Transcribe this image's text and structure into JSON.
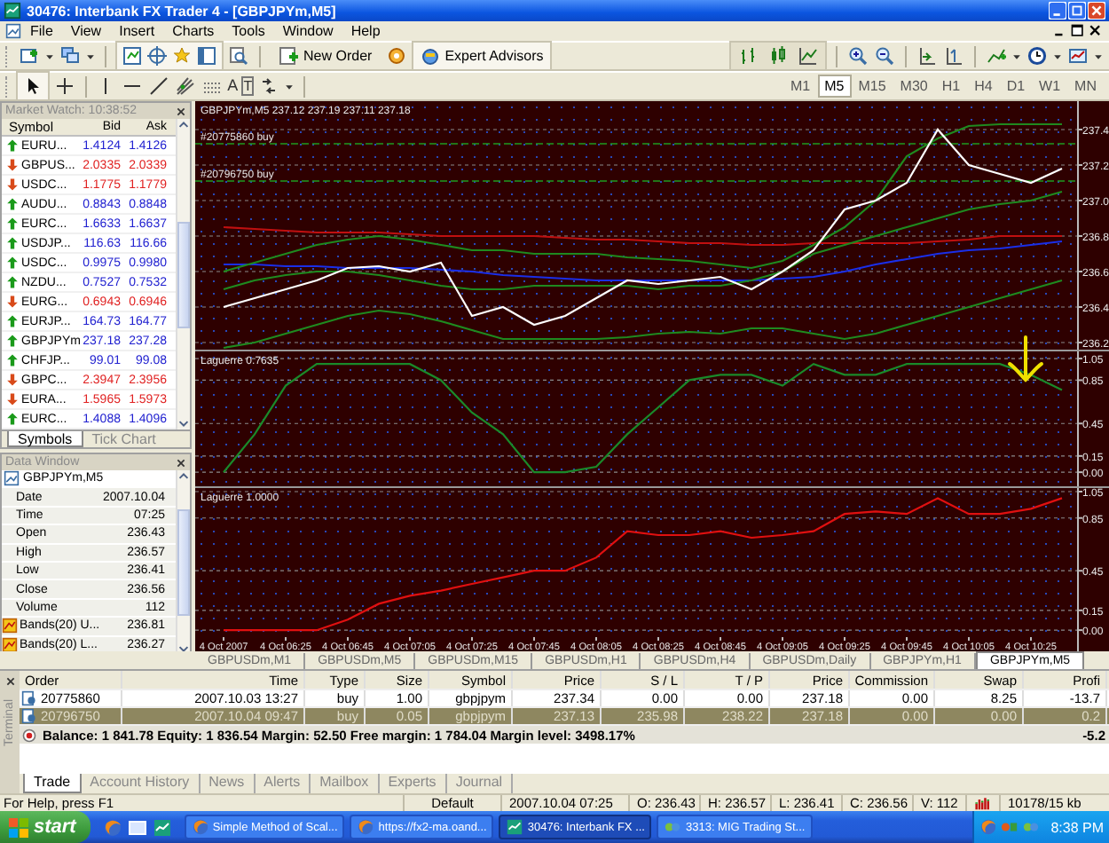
{
  "window": {
    "title": "30476: Interbank FX Trader 4 - [GBPJPYm,M5]"
  },
  "menu": [
    "File",
    "View",
    "Insert",
    "Charts",
    "Tools",
    "Window",
    "Help"
  ],
  "toolbar": {
    "buttons": [
      {
        "kind": "new-order",
        "label": "New Order"
      },
      {
        "kind": "expert-advisors",
        "label": "Expert Advisors"
      }
    ]
  },
  "drawing_tools": [
    {
      "kind": "text",
      "label": "A"
    },
    {
      "kind": "label",
      "label": "T"
    }
  ],
  "timeframes": [
    {
      "label": "M1",
      "selected": false
    },
    {
      "label": "M5",
      "selected": true
    },
    {
      "label": "M15",
      "selected": false
    },
    {
      "label": "M30",
      "selected": false
    },
    {
      "label": "H1",
      "selected": false
    },
    {
      "label": "H4",
      "selected": false
    },
    {
      "label": "D1",
      "selected": false
    },
    {
      "label": "W1",
      "selected": false
    },
    {
      "label": "MN",
      "selected": false
    }
  ],
  "market_watch": {
    "title": "Market Watch: 10:38:52",
    "columns": [
      "Symbol",
      "Bid",
      "Ask"
    ],
    "rows": [
      {
        "symbol": "EURU...",
        "bid": "1.4124",
        "ask": "1.4126",
        "rising": true
      },
      {
        "symbol": "GBPUS...",
        "bid": "2.0335",
        "ask": "2.0339",
        "rising": false
      },
      {
        "symbol": "USDC...",
        "bid": "1.1775",
        "ask": "1.1779",
        "rising": false
      },
      {
        "symbol": "AUDU...",
        "bid": "0.8843",
        "ask": "0.8848",
        "rising": true
      },
      {
        "symbol": "EURC...",
        "bid": "1.6633",
        "ask": "1.6637",
        "rising": true
      },
      {
        "symbol": "USDJP...",
        "bid": "116.63",
        "ask": "116.66",
        "rising": true
      },
      {
        "symbol": "USDC...",
        "bid": "0.9975",
        "ask": "0.9980",
        "rising": true
      },
      {
        "symbol": "NZDU...",
        "bid": "0.7527",
        "ask": "0.7532",
        "rising": true
      },
      {
        "symbol": "EURG...",
        "bid": "0.6943",
        "ask": "0.6946",
        "rising": false
      },
      {
        "symbol": "EURJP...",
        "bid": "164.73",
        "ask": "164.77",
        "rising": true
      },
      {
        "symbol": "GBPJPYm",
        "bid": "237.18",
        "ask": "237.28",
        "rising": true
      },
      {
        "symbol": "CHFJP...",
        "bid": "99.01",
        "ask": "99.08",
        "rising": true
      },
      {
        "symbol": "GBPC...",
        "bid": "2.3947",
        "ask": "2.3956",
        "rising": false
      },
      {
        "symbol": "EURA...",
        "bid": "1.5965",
        "ask": "1.5973",
        "rising": false
      },
      {
        "symbol": "EURC...",
        "bid": "1.4088",
        "ask": "1.4096",
        "rising": true
      }
    ],
    "tabs": [
      {
        "label": "Symbols",
        "selected": true
      },
      {
        "label": "Tick Chart",
        "selected": false
      }
    ]
  },
  "data_window": {
    "title": "Data Window",
    "chart": "GBPJPYm,M5",
    "rows": [
      {
        "kind": "field",
        "label": "Date",
        "value": "2007.10.04"
      },
      {
        "kind": "field",
        "label": "Time",
        "value": "07:25"
      },
      {
        "kind": "field",
        "label": "Open",
        "value": "236.43"
      },
      {
        "kind": "field",
        "label": "High",
        "value": "236.57"
      },
      {
        "kind": "field",
        "label": "Low",
        "value": "236.41"
      },
      {
        "kind": "field",
        "label": "Close",
        "value": "236.56"
      },
      {
        "kind": "field",
        "label": "Volume",
        "value": "112"
      },
      {
        "kind": "indicator",
        "label": "Bands(20) U...",
        "value": "236.81"
      },
      {
        "kind": "indicator",
        "label": "Bands(20) L...",
        "value": "236.27"
      }
    ]
  },
  "charts": [
    {
      "chart_data": {
        "type": "line",
        "title": "GBPJPYm,M5  237.12 237.19 237.11 237.18",
        "ylim": [
          236.16,
          237.56
        ],
        "yticks": [
          {
            "value": 237.4,
            "label": "237.4"
          },
          {
            "value": 237.2,
            "label": "237.2"
          },
          {
            "value": 237.0,
            "label": "237.0"
          },
          {
            "value": 236.8,
            "label": "236.8"
          },
          {
            "value": 236.6,
            "label": "236.6"
          },
          {
            "value": 236.4,
            "label": "236.4"
          },
          {
            "value": 236.2,
            "label": "236.2"
          }
        ],
        "series": [
          {
            "color": "#c01010",
            "values": [
              236.85,
              236.84,
              236.83,
              236.82,
              236.82,
              236.82,
              236.81,
              236.8,
              236.8,
              236.8,
              236.8,
              236.79,
              236.78,
              236.78,
              236.77,
              236.76,
              236.76,
              236.75,
              236.75,
              236.76,
              236.76,
              236.76,
              236.76,
              236.77,
              236.78,
              236.8,
              236.8,
              236.8
            ]
          },
          {
            "color": "#1a2ee8",
            "values": [
              236.64,
              236.64,
              236.63,
              236.63,
              236.62,
              236.62,
              236.62,
              236.61,
              236.6,
              236.58,
              236.57,
              236.56,
              236.55,
              236.55,
              236.55,
              236.55,
              236.55,
              236.55,
              236.56,
              236.57,
              236.6,
              236.64,
              236.67,
              236.7,
              236.72,
              236.73,
              236.75,
              236.77
            ]
          },
          {
            "color": "#1f8a1f",
            "values": [
              236.6,
              236.65,
              236.7,
              236.75,
              236.78,
              236.8,
              236.78,
              236.75,
              236.72,
              236.72,
              236.7,
              236.7,
              236.7,
              236.68,
              236.67,
              236.66,
              236.64,
              236.62,
              236.66,
              236.75,
              236.85,
              237.0,
              237.25,
              237.35,
              237.42,
              237.43,
              237.43,
              237.43
            ]
          },
          {
            "color": "#1f8a1f",
            "values": [
              236.5,
              236.55,
              236.58,
              236.6,
              236.6,
              236.58,
              236.55,
              236.52,
              236.5,
              236.5,
              236.52,
              236.52,
              236.52,
              236.52,
              236.5,
              236.52,
              236.52,
              236.55,
              236.6,
              236.7,
              236.75,
              236.8,
              236.85,
              236.9,
              236.95,
              236.98,
              237.0,
              237.05
            ]
          },
          {
            "color": "#1f8a1f",
            "values": [
              236.17,
              236.2,
              236.25,
              236.3,
              236.35,
              236.38,
              236.36,
              236.32,
              236.27,
              236.22,
              236.22,
              236.22,
              236.22,
              236.23,
              236.25,
              236.26,
              236.25,
              236.28,
              236.28,
              236.25,
              236.22,
              236.25,
              236.3,
              236.35,
              236.4,
              236.45,
              236.5,
              236.55
            ]
          },
          {
            "color": "#ffffff",
            "values": [
              236.4,
              236.45,
              236.5,
              236.55,
              236.62,
              236.63,
              236.6,
              236.65,
              236.35,
              236.4,
              236.3,
              236.35,
              236.45,
              236.55,
              236.53,
              236.55,
              236.57,
              236.5,
              236.6,
              236.72,
              236.95,
              237.0,
              237.1,
              237.4,
              237.2,
              237.15,
              237.1,
              237.18
            ]
          }
        ],
        "grid": true,
        "ref_lines": [
          {
            "axis": "y",
            "value": 237.32,
            "label": "#20775860 buy"
          },
          {
            "axis": "y",
            "value": 237.11,
            "label": "#20796750 buy"
          }
        ]
      }
    },
    {
      "chart_data": {
        "type": "line",
        "title": "Laguerre 0.7635",
        "ylim": [
          -0.13,
          1.116
        ],
        "grid": true,
        "yticks": [
          {
            "value": 1.05,
            "label": "1.05"
          },
          {
            "value": 0.85,
            "label": "0.85"
          },
          {
            "value": 0.45,
            "label": "0.45"
          },
          {
            "value": 0.15,
            "label": "0.15"
          },
          {
            "value": 0,
            "label": "0.00"
          }
        ],
        "series": [
          {
            "color": "#1a8a2a",
            "values": [
              0.0,
              0.35,
              0.8,
              1.0,
              1.0,
              1.0,
              1.0,
              0.85,
              0.55,
              0.35,
              0.0,
              0.0,
              0.05,
              0.35,
              0.6,
              0.85,
              0.9,
              0.9,
              0.8,
              1.0,
              0.9,
              0.9,
              1.0,
              1.0,
              1.0,
              1.0,
              0.9,
              0.76
            ]
          }
        ]
      }
    },
    {
      "chart_data": {
        "type": "line",
        "title": "Laguerre 1.0000",
        "ylim": [
          -0.053,
          1.077
        ],
        "grid": true,
        "categories": [
          "4 Oct 2007",
          null,
          "4 Oct 06:25",
          null,
          "4 Oct 06:45",
          null,
          "4 Oct 07:05",
          null,
          "4 Oct 07:25",
          null,
          "4 Oct 07:45",
          null,
          "4 Oct 08:05",
          null,
          "4 Oct 08:25",
          null,
          "4 Oct 08:45",
          null,
          "4 Oct 09:05",
          null,
          "4 Oct 09:25",
          null,
          "4 Oct 09:45",
          null,
          "4 Oct 10:05",
          null,
          "4 Oct 10:25",
          null
        ],
        "yticks": [
          {
            "value": 1.05,
            "label": "1.05"
          },
          {
            "value": 0.85,
            "label": "0.85"
          },
          {
            "value": 0.45,
            "label": "0.45"
          },
          {
            "value": 0.15,
            "label": "0.15"
          },
          {
            "value": 0,
            "label": "0.00"
          }
        ],
        "series": [
          {
            "color": "#e01010",
            "values": [
              0,
              0,
              0,
              0,
              0.08,
              0.2,
              0.26,
              0.3,
              0.35,
              0.4,
              0.45,
              0.45,
              0.55,
              0.75,
              0.72,
              0.72,
              0.75,
              0.7,
              0.72,
              0.75,
              0.88,
              0.9,
              0.88,
              1.0,
              0.88,
              0.88,
              0.92,
              1.0
            ]
          }
        ]
      }
    }
  ],
  "chart_tabs": [
    {
      "label": "GBPUSDm,M1",
      "selected": false
    },
    {
      "label": "GBPUSDm,M5",
      "selected": false
    },
    {
      "label": "GBPUSDm,M15",
      "selected": false
    },
    {
      "label": "GBPUSDm,H1",
      "selected": false
    },
    {
      "label": "GBPUSDm,H4",
      "selected": false
    },
    {
      "label": "GBPUSDm,Daily",
      "selected": false
    },
    {
      "label": "GBPJPYm,H1",
      "selected": false
    },
    {
      "label": "GBPJPYm,M5",
      "selected": true
    }
  ],
  "terminal": {
    "title": "Terminal",
    "columns": [
      "Order",
      "Time",
      "Type",
      "Size",
      "Symbol",
      "Price",
      "S / L",
      "T / P",
      "Price",
      "Commission",
      "Swap",
      "Profi"
    ],
    "rows": [
      {
        "selected": false,
        "cells": [
          "20775860",
          "2007.10.03 13:27",
          "buy",
          "1.00",
          "gbpjpym",
          "237.34",
          "0.00",
          "0.00",
          "237.18",
          "0.00",
          "8.25",
          "-13.7"
        ]
      },
      {
        "selected": true,
        "cells": [
          "20796750",
          "2007.10.04 09:47",
          "buy",
          "0.05",
          "gbpjpym",
          "237.13",
          "235.98",
          "238.22",
          "237.18",
          "0.00",
          "0.00",
          "0.2"
        ]
      }
    ],
    "summary": {
      "text": "Balance: 1 841.78  Equity: 1 836.54  Margin: 52.50  Free margin: 1 784.04  Margin level: 3498.17%",
      "profit": "-5.2"
    },
    "tabs": [
      {
        "label": "Trade",
        "selected": true
      },
      {
        "label": "Account History",
        "selected": false
      },
      {
        "label": "News",
        "selected": false
      },
      {
        "label": "Alerts",
        "selected": false
      },
      {
        "label": "Mailbox",
        "selected": false
      },
      {
        "label": "Experts",
        "selected": false
      },
      {
        "label": "Journal",
        "selected": false
      }
    ]
  },
  "status_bar": {
    "help": "For Help, press F1",
    "items": [
      "Default",
      "2007.10.04 07:25",
      "O: 236.43",
      "H: 236.57",
      "L: 236.41",
      "C: 236.56",
      "V: 112",
      "10178/15 kb"
    ]
  },
  "taskbar": {
    "start": "start",
    "tasks": [
      {
        "kind": "browser",
        "label": "Simple Method of Scal...",
        "selected": false
      },
      {
        "kind": "browser",
        "label": "https://fx2-ma.oand...",
        "selected": false
      },
      {
        "kind": "app",
        "label": "30476: Interbank FX ...",
        "selected": true
      },
      {
        "kind": "chat",
        "label": "3313: MIG Trading St...",
        "selected": false
      }
    ],
    "clock": "8:38 PM"
  }
}
